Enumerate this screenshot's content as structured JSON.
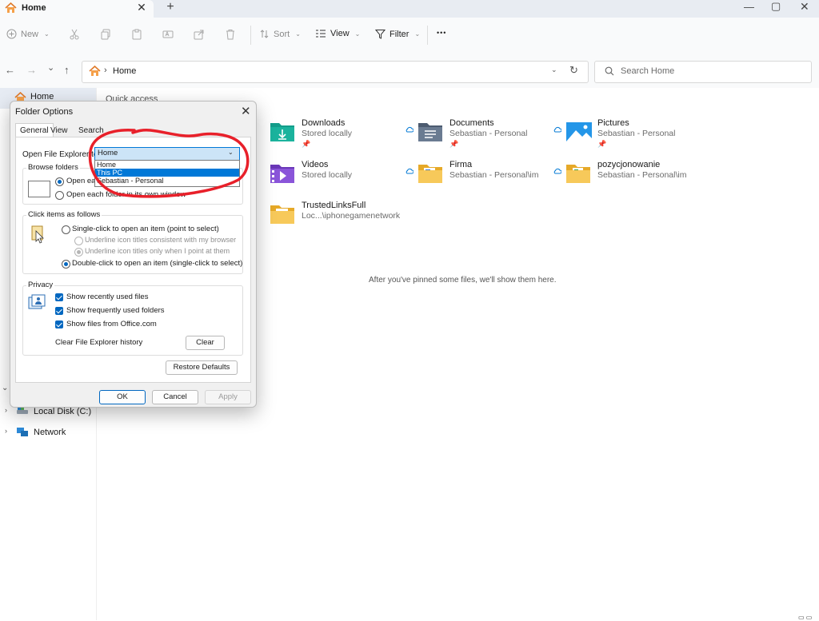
{
  "tab": {
    "title": "Home",
    "close": "✕",
    "new_tab": "+"
  },
  "window": {
    "minimize": "—",
    "maximize": "▢",
    "close": "✕"
  },
  "toolbar": {
    "new_label": "New",
    "sort_label": "Sort",
    "view_label": "View",
    "filter_label": "Filter",
    "more_label": "•••"
  },
  "nav": {
    "back": "←",
    "forward": "→",
    "recent": "⌄",
    "up": "↑"
  },
  "address": {
    "separator": "›",
    "path": "Home",
    "chevron": "⌄",
    "refresh": "↻"
  },
  "search": {
    "placeholder": "Search Home"
  },
  "sidebar": {
    "home_label": "Home",
    "items": [
      {
        "label": "Local Disk (C:)"
      },
      {
        "label": "Network"
      }
    ]
  },
  "main": {
    "quick_access_title": "Quick access",
    "items": [
      {
        "name": "Downloads",
        "sub": "Stored locally",
        "icon": "downloads-folder-icon",
        "color": "#1a9e8a"
      },
      {
        "name": "Documents",
        "sub": "Sebastian - Personal",
        "icon": "documents-folder-icon",
        "color": "#5b6b82"
      },
      {
        "name": "Pictures",
        "sub": "Sebastian - Personal",
        "icon": "pictures-folder-icon",
        "color": "#1e8fd8"
      },
      {
        "name": "Videos",
        "sub": "Stored locally",
        "icon": "videos-folder-icon",
        "color": "#7a45c9"
      },
      {
        "name": "Firma",
        "sub": "Sebastian - Personal\\im",
        "icon": "folder-icon",
        "color": "#f2c14e"
      },
      {
        "name": "pozycjonowanie",
        "sub": "Sebastian - Personal\\im",
        "icon": "folder-icon",
        "color": "#f2c14e"
      },
      {
        "name": "TrustedLinksFull",
        "sub": "Loc...\\iphonegamenetwork",
        "icon": "folder-icon",
        "color": "#f2c14e"
      }
    ],
    "empty_message": "After you've pinned some files, we'll show them here."
  },
  "dialog": {
    "title": "Folder Options",
    "tabs": [
      "General",
      "View",
      "Search"
    ],
    "open_explorer_label": "Open File Explorer to:",
    "combo_value": "Home",
    "dropdown_options": [
      "Home",
      "This PC",
      "Sebastian - Personal"
    ],
    "dropdown_selected": "This PC",
    "browse_group": "Browse folders",
    "browse_opt1": "Open each folder in the same window",
    "browse_opt2": "Open each folder in its own window",
    "click_group": "Click items as follows",
    "single_click": "Single-click to open an item (point to select)",
    "underline_consistent": "Underline icon titles consistent with my browser",
    "underline_point": "Underline icon titles only when I point at them",
    "double_click": "Double-click to open an item (single-click to select)",
    "privacy_group": "Privacy",
    "show_recent_files": "Show recently used files",
    "show_frequent_folders": "Show frequently used folders",
    "show_office_files": "Show files from Office.com",
    "clear_history_label": "Clear File Explorer history",
    "clear_button": "Clear",
    "restore_button": "Restore Defaults",
    "ok_button": "OK",
    "cancel_button": "Cancel",
    "apply_button": "Apply"
  },
  "colors": {
    "accent": "#0067c0",
    "annotation": "#e8202a",
    "folder": "#f2c14e"
  }
}
